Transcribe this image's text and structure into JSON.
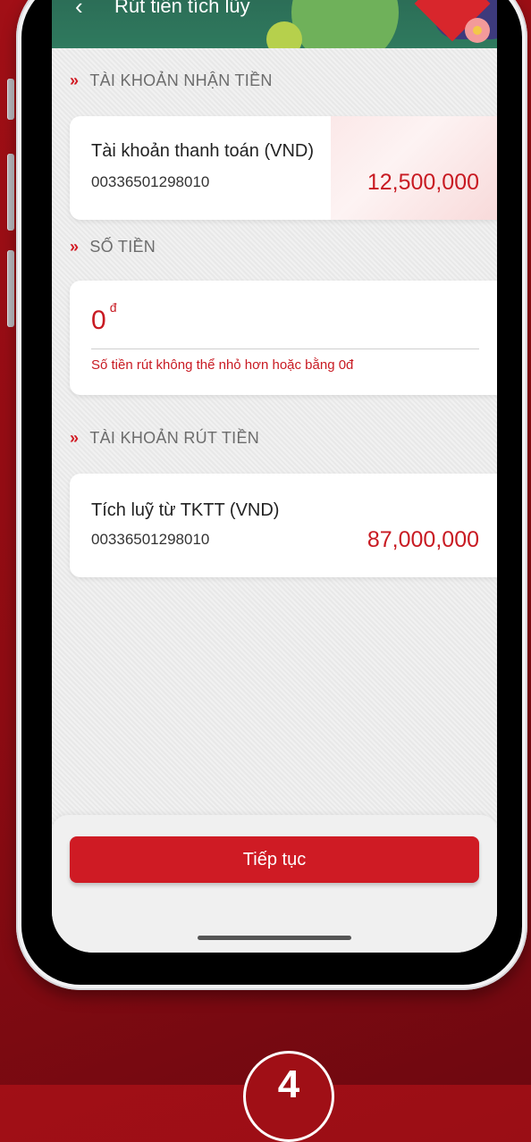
{
  "header": {
    "title": "Rút tiền tích lũy",
    "back_icon": "chevron-left-icon"
  },
  "receive_section": {
    "label": "TÀI KHOẢN NHẬN TIỀN",
    "account_name": "Tài khoản thanh toán (VND)",
    "account_number": "00336501298010",
    "balance": "12,500,000"
  },
  "amount_section": {
    "label": "SỐ TIỀN",
    "value": "0",
    "currency_symbol": "đ",
    "error_message": "Số tiền rút không thể nhỏ hơn hoặc bằng 0đ"
  },
  "withdraw_section": {
    "label": "TÀI KHOẢN RÚT TIỀN",
    "account_name": "Tích luỹ từ TKTT (VND)",
    "account_number": "00336501298010",
    "balance": "87,000,000"
  },
  "footer": {
    "continue_label": "Tiếp tục"
  },
  "step": {
    "number": "4"
  },
  "colors": {
    "accent": "#cf1b24",
    "background": "#a10f16"
  }
}
